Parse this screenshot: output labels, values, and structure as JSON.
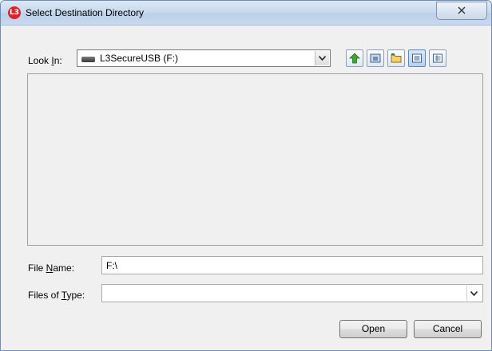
{
  "window": {
    "title": "Select Destination Directory",
    "app_icon_text": "L3",
    "close_glyph": "X"
  },
  "look_in": {
    "label_prefix": "Look ",
    "label_mnemonic": "I",
    "label_suffix": "n:",
    "value": "L3SecureUSB (F:)",
    "icon": "usb-drive-icon"
  },
  "toolbar": {
    "buttons": [
      "up-one-level-icon",
      "desktop-icon",
      "new-folder-icon",
      "list-view-icon",
      "details-view-icon"
    ],
    "active": "list-view-icon"
  },
  "file_name": {
    "label_prefix": "File ",
    "label_mnemonic": "N",
    "label_suffix": "ame:",
    "value": "F:\\"
  },
  "files_of_type": {
    "label_prefix": "Files of ",
    "label_mnemonic": "T",
    "label_suffix": "ype:",
    "value": ""
  },
  "buttons": {
    "open": "Open",
    "cancel": "Cancel"
  },
  "colors": {
    "up_arrow": "#3fa535",
    "app_icon": "#d8262b"
  }
}
